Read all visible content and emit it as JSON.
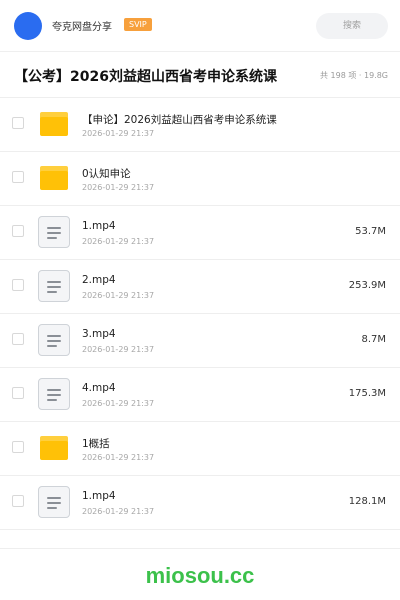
{
  "header": {
    "brand": "夸克网盘分享",
    "vip_badge": "SVIP",
    "search_placeholder": "搜索"
  },
  "folder": {
    "title": "【公考】2026刘益超山西省考申论系统课",
    "meta": "共 198 项 · 19.8G"
  },
  "items": [
    {
      "type": "folder",
      "name": "【申论】2026刘益超山西省考申论系统课",
      "date": "2026-01-29 21:37",
      "size": ""
    },
    {
      "type": "folder",
      "name": "0认知申论",
      "date": "2026-01-29 21:37",
      "size": ""
    },
    {
      "type": "file",
      "name": "1.mp4",
      "date": "2026-01-29 21:37",
      "size": "53.7M"
    },
    {
      "type": "file",
      "name": "2.mp4",
      "date": "2026-01-29 21:37",
      "size": "253.9M"
    },
    {
      "type": "file",
      "name": "3.mp4",
      "date": "2026-01-29 21:37",
      "size": "8.7M"
    },
    {
      "type": "file",
      "name": "4.mp4",
      "date": "2026-01-29 21:37",
      "size": "175.3M"
    },
    {
      "type": "folder",
      "name": "1概括",
      "date": "2026-01-29 21:37",
      "size": ""
    },
    {
      "type": "file",
      "name": "1.mp4",
      "date": "2026-01-29 21:37",
      "size": "128.1M"
    }
  ],
  "watermark": "miosou.cc",
  "colors": {
    "avatar": "#2a6cf0",
    "vip": "#f7a03c",
    "folder": "#ffc107",
    "watermark": "#3cc14b"
  }
}
